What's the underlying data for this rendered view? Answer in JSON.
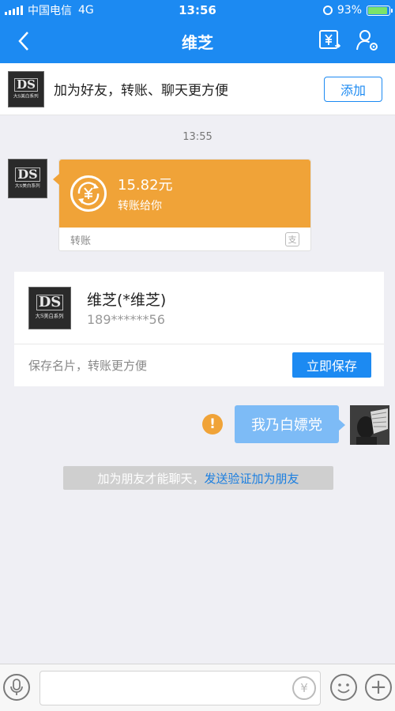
{
  "status_bar": {
    "carrier": "中国电信",
    "network": "4G",
    "time": "13:56",
    "battery_text": "93%",
    "battery_level": 0.93
  },
  "nav": {
    "title": "维芝",
    "icons": [
      "back-arrow-icon",
      "transfer-yen-icon",
      "profile-settings-icon"
    ]
  },
  "add_bar": {
    "avatar_main": "DS",
    "avatar_sub": "大S美白系列",
    "text": "加为好友，转账、聊天更方便",
    "button": "添加"
  },
  "chat": {
    "timestamp": "13:55",
    "transfer": {
      "amount": "15.82元",
      "subtitle": "转账给你",
      "footer": "转账",
      "color": "#f0a338"
    },
    "contact_card": {
      "name": "维芝(*维芝)",
      "phone": "189******56",
      "hint": "保存名片，转账更方便",
      "button": "立即保存"
    },
    "my_message": {
      "text": "我乃白嫖党",
      "status_icon": "warning-icon"
    },
    "system_tip": {
      "text": "加为朋友才能聊天，",
      "link": "发送验证加为朋友"
    }
  },
  "input_bar": {
    "icons": [
      "voice-icon",
      "transfer-yen-icon",
      "emoji-icon",
      "plus-icon"
    ],
    "placeholder": ""
  },
  "colors": {
    "header": "#1c8af2",
    "accent": "#1c8af2",
    "transfer_orange": "#f0a338",
    "my_bubble": "#7dbbf6"
  }
}
